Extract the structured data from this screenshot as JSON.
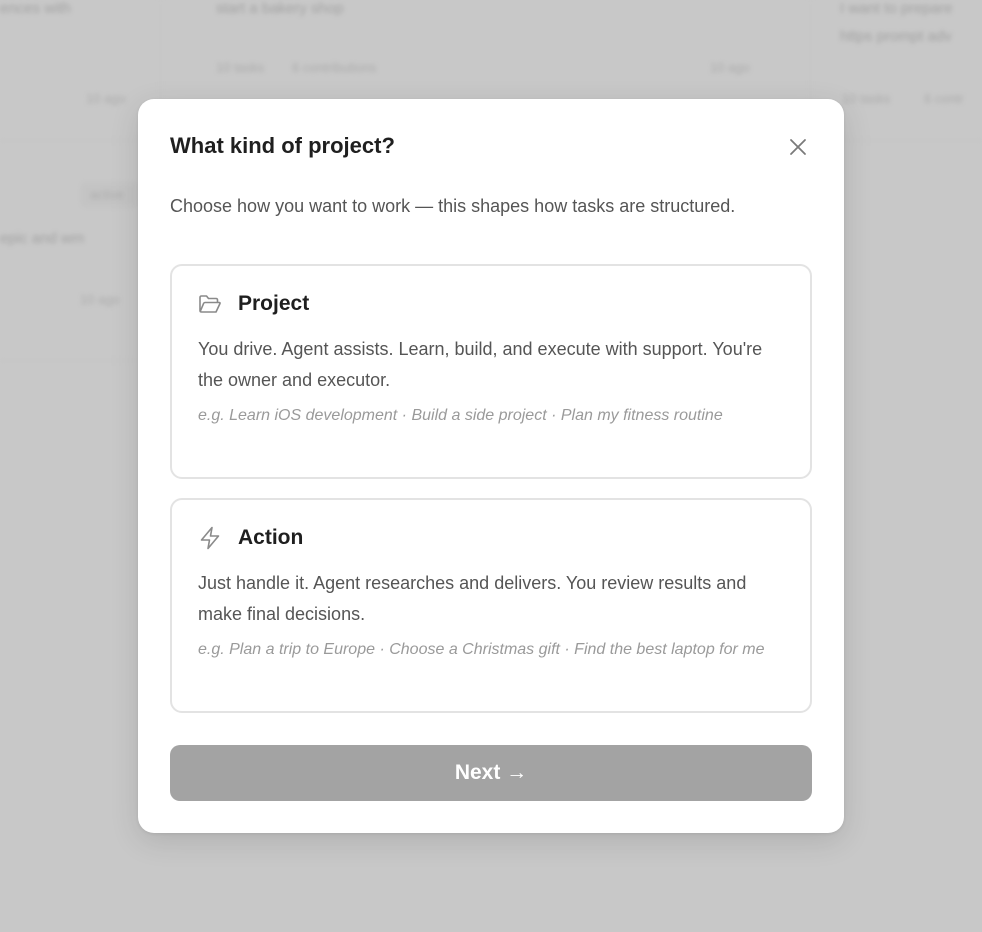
{
  "background": {
    "left_col": {
      "text_top": "ences with",
      "time_1": "10 ago",
      "pill_text": "active",
      "row_text": "epic and wm",
      "time_2": "10 ago"
    },
    "mid_col": {
      "title": "start a bakery shop",
      "meta_left": "10 tasks",
      "meta_mid": "6 contributions",
      "meta_right": "10 ago"
    },
    "right_col": {
      "line_1": "I want to prepare",
      "line_2": "https prompt adv",
      "meta_left": "10 tasks",
      "meta_right": "6 contr"
    }
  },
  "modal": {
    "title": "What kind of project?",
    "close_icon": "close-icon",
    "subtitle": "Choose how you want to work — this shapes how tasks are structured.",
    "options": [
      {
        "icon": "folder-icon",
        "title": "Project",
        "description": "You drive. Agent assists. Learn, build, and execute with support. You're the owner and executor.",
        "example": "e.g. Learn iOS development · Build a side project · Plan my fitness routine"
      },
      {
        "icon": "lightning-icon",
        "title": "Action",
        "description": "Just handle it. Agent researches and delivers. You review results and make final decisions.",
        "example": "e.g. Plan a trip to Europe · Choose a Christmas gift · Find the best laptop for me"
      }
    ],
    "next_label": "Next →"
  },
  "colors": {
    "backdrop": "#c8c8c8",
    "modal_bg": "#ffffff",
    "card_border": "#e3e3e3",
    "button_disabled": "#a3a3a3",
    "text_primary": "#1f1f1f",
    "text_secondary": "#555555",
    "text_muted": "#9a9a9a"
  }
}
